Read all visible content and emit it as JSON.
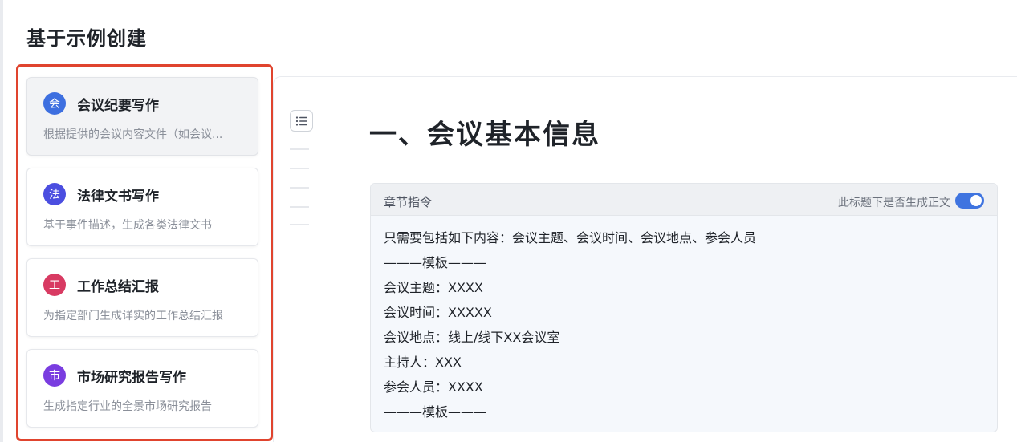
{
  "dialog": {
    "title": "基于示例创建"
  },
  "templates": [
    {
      "badge": "会",
      "title": "会议纪要写作",
      "desc": "根据提供的会议内容文件（如会议...",
      "color": "#3d6fe0"
    },
    {
      "badge": "法",
      "title": "法律文书写作",
      "desc": "基于事件描述，生成各类法律文书",
      "color": "#4b4ee0"
    },
    {
      "badge": "工",
      "title": "工作总结汇报",
      "desc": "为指定部门生成详实的工作总结汇报",
      "color": "#d83a62"
    },
    {
      "badge": "市",
      "title": "市场研究报告写作",
      "desc": "生成指定行业的全景市场研究报告",
      "color": "#7a3de0"
    }
  ],
  "preview": {
    "heading": "一、会议基本信息",
    "instruction": {
      "label": "章节指令",
      "toggle_label": "此标题下是否生成正文",
      "toggle_on": true,
      "lines": [
        "只需要包括如下内容：会议主题、会议时间、会议地点、参会人员",
        "———模板———",
        "会议主题：XXXX",
        "会议时间：XXXXX",
        "会议地点：线上/线下XX会议室",
        "主持人：XXX",
        "参会人员：XXXX",
        "———模板———"
      ]
    }
  },
  "colors": {
    "highlight": "#e0442e",
    "accent": "#3f74e0"
  },
  "icons": {
    "outline_toggle": "outline-list-icon"
  }
}
